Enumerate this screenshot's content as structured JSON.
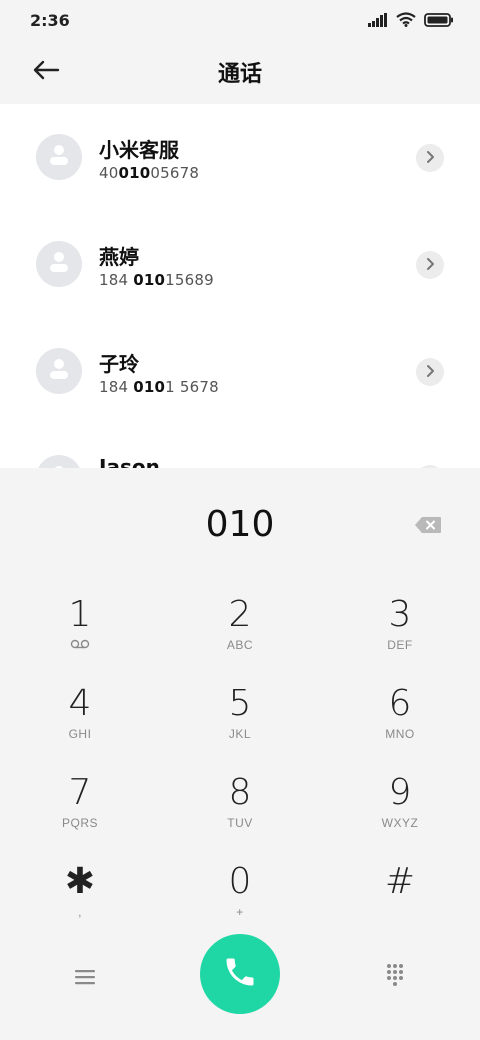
{
  "status_bar": {
    "time": "2:36"
  },
  "header": {
    "title": "通话"
  },
  "contacts": [
    {
      "name": "小米客服",
      "number_parts": [
        "40",
        "010",
        "05678"
      ]
    },
    {
      "name": "燕婷",
      "number_parts": [
        "184 ",
        "010",
        "15689"
      ]
    },
    {
      "name": "子玲",
      "number_parts": [
        "184 ",
        "010",
        "1 5678"
      ]
    },
    {
      "name": "Jason",
      "number_parts": [
        "",
        "",
        ""
      ]
    }
  ],
  "dialpad": {
    "entry": "010",
    "keys": [
      {
        "digit": "1",
        "letters": ""
      },
      {
        "digit": "2",
        "letters": "ABC"
      },
      {
        "digit": "3",
        "letters": "DEF"
      },
      {
        "digit": "4",
        "letters": "GHI"
      },
      {
        "digit": "5",
        "letters": "JKL"
      },
      {
        "digit": "6",
        "letters": "MNO"
      },
      {
        "digit": "7",
        "letters": "PQRS"
      },
      {
        "digit": "8",
        "letters": "TUV"
      },
      {
        "digit": "9",
        "letters": "WXYZ"
      },
      {
        "digit": "✱",
        "letters": ","
      },
      {
        "digit": "0",
        "letters": "+"
      },
      {
        "digit": "#",
        "letters": ""
      }
    ]
  },
  "colors": {
    "call_button": "#1fd7a4",
    "list_bg": "#ffffff",
    "pad_bg": "#f4f4f4"
  },
  "icons": [
    "back-arrow-icon",
    "signal-icon",
    "wifi-icon",
    "battery-icon",
    "person-icon",
    "chevron-right-icon",
    "backspace-icon",
    "voicemail-icon",
    "menu-icon",
    "phone-icon",
    "dialpad-icon"
  ]
}
